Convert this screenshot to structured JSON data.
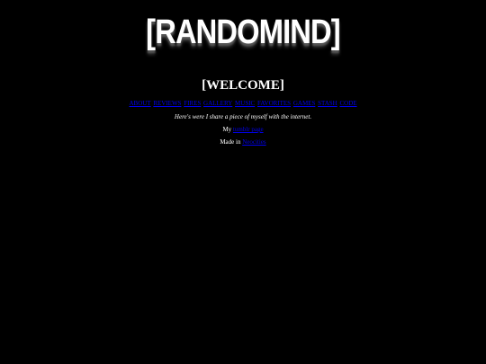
{
  "site": {
    "logo_text": "[RANDOMIND]"
  },
  "main": {
    "heading": "[WELCOME]",
    "nav_links": [
      {
        "label": "ABOUT"
      },
      {
        "label": "REVIEWS"
      },
      {
        "label": "FIRES"
      },
      {
        "label": "GALLERY"
      },
      {
        "label": "MUSIC"
      },
      {
        "label": "FAVORITES"
      },
      {
        "label": "GAMES"
      },
      {
        "label": "STASH"
      },
      {
        "label": "CODE"
      }
    ],
    "tagline": "Here's were I share a piece of myself with the internet.",
    "tumblr_prefix": "My ",
    "tumblr_link": "tumblr page",
    "made_prefix": "Made in ",
    "made_link": "Neocities"
  },
  "colors": {
    "background": "#000000",
    "text": "#ffffff",
    "link": "#0000ee"
  }
}
